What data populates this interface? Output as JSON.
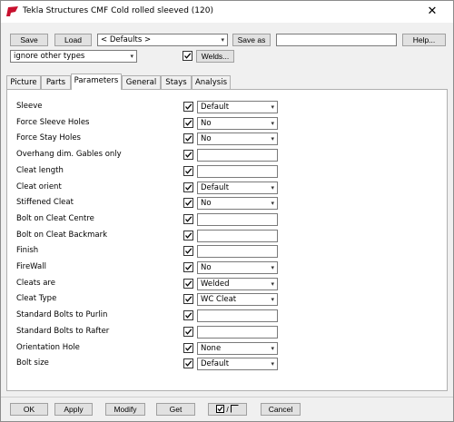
{
  "window": {
    "title": "Tekla Structures  CMF Cold rolled sleeved (120)",
    "close_glyph": "✕"
  },
  "toolbar": {
    "save_label": "Save",
    "load_label": "Load",
    "preset_value": "< Defaults >",
    "save_as_label": "Save as",
    "save_as_value": "",
    "help_label": "Help...",
    "filter_value": "ignore other types",
    "welds_label": "Welds..."
  },
  "tabs": [
    {
      "label": "Picture",
      "active": false
    },
    {
      "label": "Parts",
      "active": false
    },
    {
      "label": "Parameters",
      "active": true
    },
    {
      "label": "General",
      "active": false
    },
    {
      "label": "Stays",
      "active": false
    },
    {
      "label": "Analysis",
      "active": false
    }
  ],
  "params": [
    {
      "label": "Sleeve",
      "type": "select",
      "value": "Default"
    },
    {
      "label": "Force Sleeve Holes",
      "type": "select",
      "value": "No"
    },
    {
      "label": "Force Stay Holes",
      "type": "select",
      "value": "No"
    },
    {
      "label": "Overhang dim. Gables only",
      "type": "text",
      "value": ""
    },
    {
      "label": "Cleat length",
      "type": "text",
      "value": ""
    },
    {
      "label": "Cleat orient",
      "type": "select",
      "value": "Default"
    },
    {
      "label": "Stiffened Cleat",
      "type": "select",
      "value": "No"
    },
    {
      "label": "Bolt on Cleat Centre",
      "type": "text",
      "value": ""
    },
    {
      "label": "Bolt on Cleat Backmark",
      "type": "text",
      "value": ""
    },
    {
      "label": "Finish",
      "type": "text",
      "value": ""
    },
    {
      "label": "FireWall",
      "type": "select",
      "value": "No"
    },
    {
      "label": "Cleats are",
      "type": "select",
      "value": "Welded"
    },
    {
      "label": "Cleat Type",
      "type": "select",
      "value": "WC Cleat"
    },
    {
      "label": "Standard Bolts to Purlin",
      "type": "text",
      "value": ""
    },
    {
      "label": "Standard Bolts to Rafter",
      "type": "text",
      "value": ""
    },
    {
      "label": "Orientation Hole",
      "type": "select",
      "value": "None"
    },
    {
      "label": "Bolt size",
      "type": "select",
      "value": "Default"
    }
  ],
  "footer": {
    "ok_label": "OK",
    "apply_label": "Apply",
    "modify_label": "Modify",
    "get_label": "Get",
    "toggle_separator": "/",
    "cancel_label": "Cancel"
  },
  "colors": {
    "brand_icon": "#c8102e",
    "tab_active_bg": "#ffffff",
    "button_bg": "#e1e1e1"
  },
  "icons": {
    "app": "tekla-logo-icon",
    "close": "close-icon",
    "dropdown": "chevron-down-icon",
    "check": "checkmark-icon"
  }
}
